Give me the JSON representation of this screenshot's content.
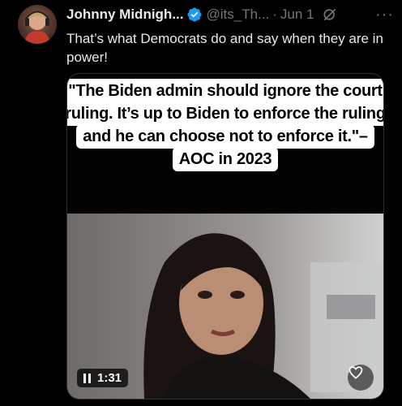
{
  "tweet": {
    "author_name": "Johnny Midnigh...",
    "handle": "@its_Th...",
    "separator": "·",
    "date": "Jun 1",
    "more": "···",
    "text": "That’s what Democrats do and say when they are in power!"
  },
  "media": {
    "caption_lines": [
      "\"The Biden admin should ignore the court",
      "ruling. It’s up to Biden to enforce the ruling",
      "and he can choose not to enforce it.\"–",
      "AOC in 2023"
    ],
    "duration": "1:31"
  },
  "icons": {
    "verified": "verified-badge-icon",
    "grok": "grok-icon",
    "more": "more-icon",
    "pause": "pause-icon",
    "heart": "heart-icon"
  },
  "colors": {
    "background": "#000000",
    "text": "#e7e9ea",
    "muted": "#71767b",
    "verified": "#1d9bf0"
  }
}
